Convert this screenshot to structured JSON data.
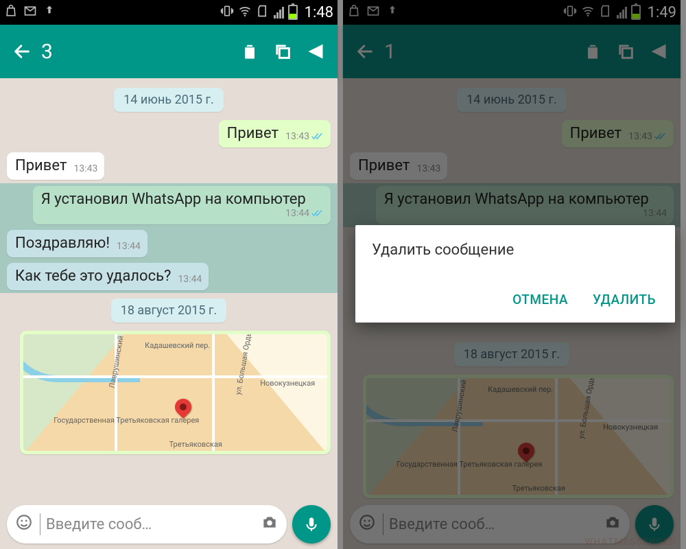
{
  "left": {
    "statusbar": {
      "time": "1:48"
    },
    "actionbar": {
      "selected_count": "3"
    },
    "dates": {
      "d1": "14 июнь 2015 г.",
      "d2": "18 август 2015 г."
    },
    "messages": {
      "m1": {
        "text": "Привет",
        "time": "13:43"
      },
      "m2": {
        "text": "Привет",
        "time": "13:43"
      },
      "m3": {
        "text": "Я установил WhatsApp на компьютер",
        "time": "13:44"
      },
      "m4": {
        "text": "Поздравляю!",
        "time": "13:44"
      },
      "m5": {
        "text": "Как тебе это удалось?",
        "time": "13:44"
      }
    },
    "map": {
      "labels": {
        "a": "Государственная Третьяковская галерея",
        "b": "Новокузнецкая",
        "c": "Третьяковская",
        "d": "Кадашевский пер.",
        "e": "Лаврушинский",
        "f": "ул. Большая Ордынка"
      }
    },
    "input": {
      "placeholder": "Введите сооб…"
    }
  },
  "right": {
    "statusbar": {
      "time": "1:49"
    },
    "actionbar": {
      "selected_count": "1"
    },
    "dates": {
      "d1": "14 июнь 2015 г.",
      "d2": "18 август 2015 г."
    },
    "messages": {
      "m1": {
        "text": "Привет",
        "time": "13:43"
      },
      "m2": {
        "text": "Привет",
        "time": "13:43"
      },
      "m3": {
        "text": "Я установил WhatsApp на компьютер",
        "time": "13:44"
      }
    },
    "map": {
      "labels": {
        "a": "Государственная Третьяковская галерея",
        "b": "Новокузнецкая",
        "c": "Третьяковская",
        "d": "Кадашевский пер.",
        "e": "Лаврушинский",
        "f": "ул. Большая Ордынка"
      }
    },
    "input": {
      "placeholder": "Введите сооб…"
    },
    "dialog": {
      "title": "Удалить сообщение",
      "cancel": "ОТМЕНА",
      "confirm": "УДАЛИТЬ"
    },
    "watermark": "WHATMESSENGER"
  }
}
